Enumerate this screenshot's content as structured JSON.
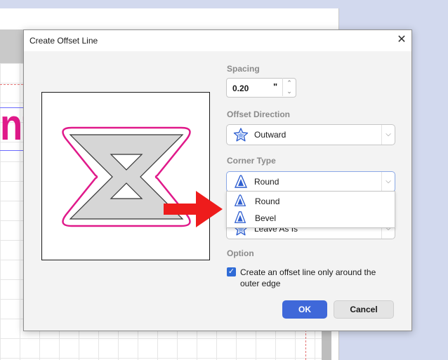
{
  "background": {
    "canvas_text": "nt"
  },
  "dialog": {
    "title": "Create Offset Line",
    "close_glyph": "✕",
    "spacing": {
      "label": "Spacing",
      "value": "0.20",
      "unit": "\"",
      "up_glyph": "⌃",
      "down_glyph": "⌄"
    },
    "offset_direction": {
      "label": "Offset Direction",
      "value": "Outward",
      "icon": "star-offset-icon"
    },
    "corner_type": {
      "label": "Corner Type",
      "value": "Round",
      "icon": "round-corner-icon",
      "options": [
        "Round",
        "Bevel"
      ]
    },
    "hidden_select": {
      "value": "Leave As Is",
      "icon": "star-offset-icon"
    },
    "option": {
      "label": "Option",
      "checkbox_text": "Create an offset line only around the outer edge",
      "checked": true
    },
    "ok_label": "OK",
    "cancel_label": "Cancel",
    "arrow_glyph": "⌵"
  },
  "colors": {
    "accent": "#3f68d9",
    "offset_line": "#e0198a",
    "annotation_arrow": "#ee1c1c"
  }
}
